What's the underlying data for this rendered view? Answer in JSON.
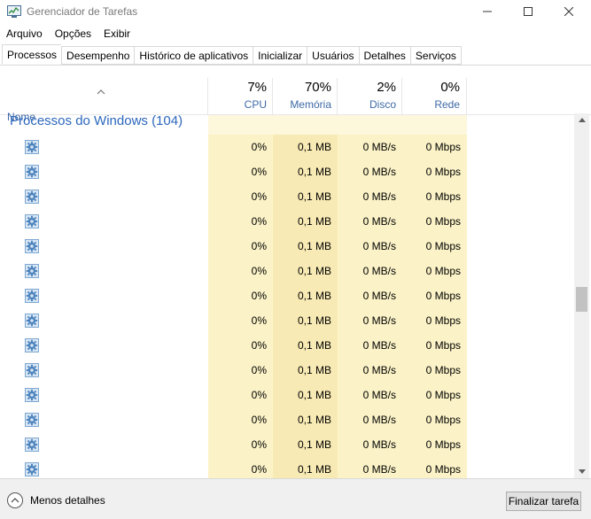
{
  "window": {
    "title": "Gerenciador de Tarefas",
    "icon": "task-manager-icon"
  },
  "menu": [
    "Arquivo",
    "Opções",
    "Exibir"
  ],
  "tabs": [
    {
      "label": "Processos",
      "active": true
    },
    {
      "label": "Desempenho",
      "active": false
    },
    {
      "label": "Histórico de aplicativos",
      "active": false
    },
    {
      "label": "Inicializar",
      "active": false
    },
    {
      "label": "Usuários",
      "active": false
    },
    {
      "label": "Detalhes",
      "active": false
    },
    {
      "label": "Serviços",
      "active": false
    }
  ],
  "columns": {
    "name": "Nome",
    "cpu": {
      "percent": "7%",
      "label": "CPU"
    },
    "memory": {
      "percent": "70%",
      "label": "Memória"
    },
    "disk": {
      "percent": "2%",
      "label": "Disco"
    },
    "network": {
      "percent": "0%",
      "label": "Rede"
    }
  },
  "group": {
    "title": "Processos do Windows (104)"
  },
  "rows": [
    {
      "icon": "gear-process-icon",
      "cpu": "0%",
      "memory": "0,1 MB",
      "disk": "0 MB/s",
      "network": "0 Mbps"
    },
    {
      "icon": "gear-process-icon",
      "cpu": "0%",
      "memory": "0,1 MB",
      "disk": "0 MB/s",
      "network": "0 Mbps"
    },
    {
      "icon": "gear-process-icon",
      "cpu": "0%",
      "memory": "0,1 MB",
      "disk": "0 MB/s",
      "network": "0 Mbps"
    },
    {
      "icon": "gear-process-icon",
      "cpu": "0%",
      "memory": "0,1 MB",
      "disk": "0 MB/s",
      "network": "0 Mbps"
    },
    {
      "icon": "gear-process-icon",
      "cpu": "0%",
      "memory": "0,1 MB",
      "disk": "0 MB/s",
      "network": "0 Mbps"
    },
    {
      "icon": "gear-process-icon",
      "cpu": "0%",
      "memory": "0,1 MB",
      "disk": "0 MB/s",
      "network": "0 Mbps"
    },
    {
      "icon": "gear-process-icon",
      "cpu": "0%",
      "memory": "0,1 MB",
      "disk": "0 MB/s",
      "network": "0 Mbps"
    },
    {
      "icon": "gear-process-icon",
      "cpu": "0%",
      "memory": "0,1 MB",
      "disk": "0 MB/s",
      "network": "0 Mbps"
    },
    {
      "icon": "gear-process-icon",
      "cpu": "0%",
      "memory": "0,1 MB",
      "disk": "0 MB/s",
      "network": "0 Mbps"
    },
    {
      "icon": "gear-process-icon",
      "cpu": "0%",
      "memory": "0,1 MB",
      "disk": "0 MB/s",
      "network": "0 Mbps"
    },
    {
      "icon": "gear-process-icon",
      "cpu": "0%",
      "memory": "0,1 MB",
      "disk": "0 MB/s",
      "network": "0 Mbps"
    },
    {
      "icon": "gear-process-icon",
      "cpu": "0%",
      "memory": "0,1 MB",
      "disk": "0 MB/s",
      "network": "0 Mbps"
    },
    {
      "icon": "gear-process-icon",
      "cpu": "0%",
      "memory": "0,1 MB",
      "disk": "0 MB/s",
      "network": "0 Mbps"
    },
    {
      "icon": "gear-process-icon",
      "cpu": "0%",
      "memory": "0,1 MB",
      "disk": "0 MB/s",
      "network": "0 Mbps"
    }
  ],
  "footer": {
    "less_details": "Menos detalhes",
    "end_task": "Finalizar tarefa"
  },
  "colors": {
    "accent_blue": "#2c67bd",
    "column_highlight": "#fbf3c7",
    "memory_highlight": "#f8eab4"
  }
}
